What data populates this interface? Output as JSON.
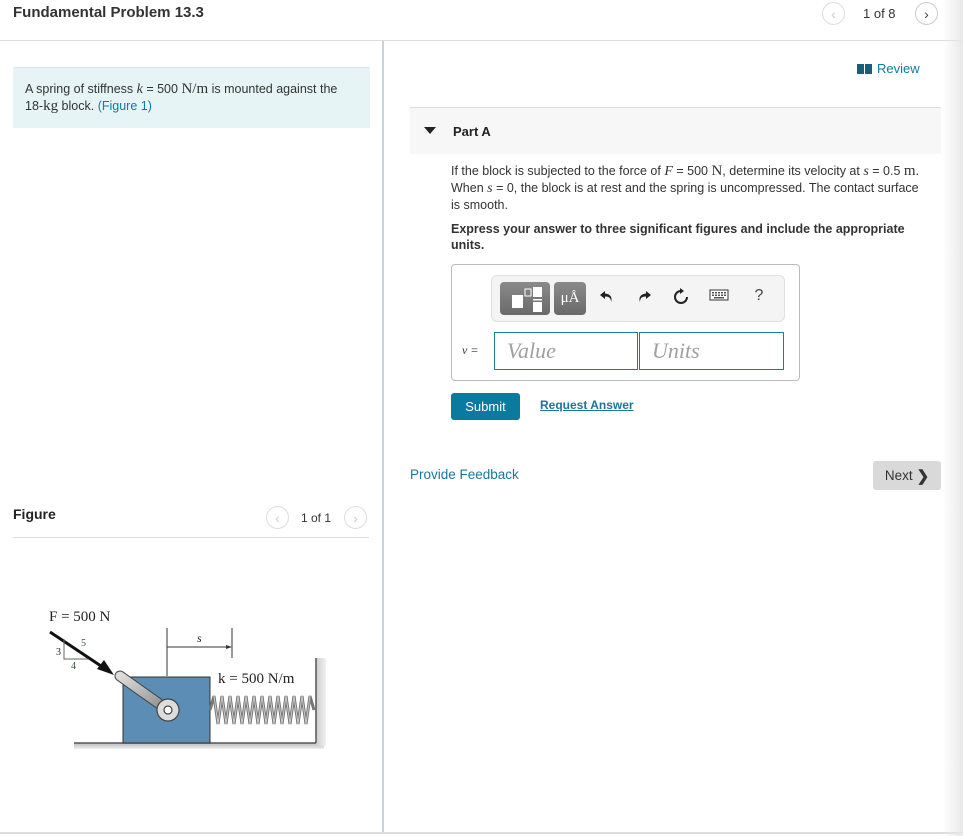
{
  "header": {
    "title": "Fundamental Problem 13.3",
    "pager": {
      "text": "1 of 8",
      "prev_icon": "chevron-left-icon",
      "next_icon": "chevron-right-icon"
    }
  },
  "intro": {
    "text_before_k": "A spring of stiffness ",
    "k_symbol": "k",
    "k_eq": " = 500 ",
    "k_unit": "N/m",
    "text_after_k": " is mounted against the 18-",
    "mass_unit": "kg",
    "text_after_mass": " block. ",
    "figure_link": "(Figure 1)"
  },
  "figure": {
    "title": "Figure",
    "pager": "1 of 1",
    "labels": {
      "force": "F = 500 N",
      "tri_3": "3",
      "tri_4": "4",
      "tri_5": "5",
      "s": "s",
      "spring": "k = 500 N/m"
    }
  },
  "review": {
    "label": "Review",
    "icon": "book-icon"
  },
  "part": {
    "label": "Part A",
    "question": {
      "t1": "If the block is subjected to the force of ",
      "F": "F",
      "t2": " = 500 ",
      "N": "N",
      "t3": ", determine its velocity at ",
      "s1": "s",
      "t4": " = 0.5 ",
      "m": "m",
      "t5": ". When ",
      "s2": "s",
      "t6": " = 0, the block is at rest and the spring is uncompressed. The contact surface is smooth."
    },
    "instruction": "Express your answer to three significant figures and include the appropriate units.",
    "toolbar": {
      "template_icon": "fraction-template-icon",
      "units_label": "μÅ",
      "undo_icon": "undo-icon",
      "redo_icon": "redo-icon",
      "reset_icon": "reset-icon",
      "keyboard_icon": "keyboard-icon",
      "help_label": "?"
    },
    "variable": "v =",
    "value_placeholder": "Value",
    "units_placeholder": "Units",
    "submit": "Submit",
    "request_answer": "Request Answer"
  },
  "footer": {
    "feedback": "Provide Feedback",
    "next": "Next"
  },
  "colors": {
    "accent": "#0a7b9e",
    "link": "#1a75a0",
    "intro_bg": "#e6f4f6",
    "field_border": "#1a7f95"
  }
}
